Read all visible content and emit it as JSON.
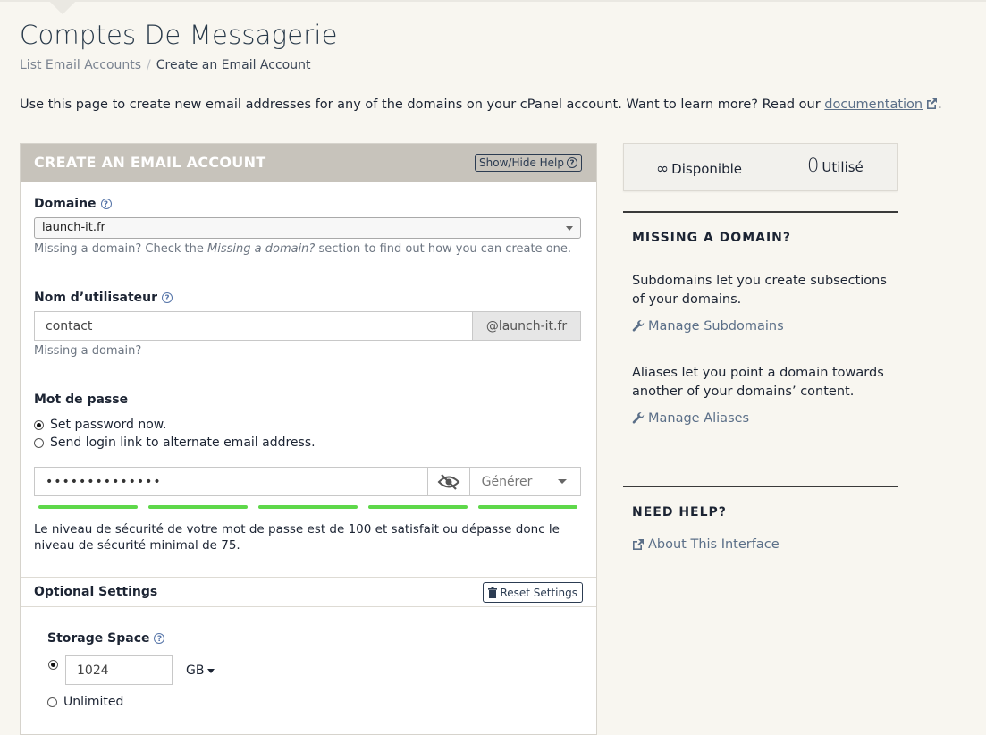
{
  "page": {
    "title": "Comptes De Messagerie",
    "breadcrumb": {
      "link": "List Email Accounts",
      "separator": "/",
      "current": "Create an Email Account"
    },
    "intro_text": "Use this page to create new email addresses for any of the domains on your cPanel account. Want to learn more? Read our",
    "intro_link": "documentation",
    "intro_end": "."
  },
  "form": {
    "header_title": "CREATE AN EMAIL ACCOUNT",
    "help_toggle_label": "Show/Hide Help",
    "domain_label": "Domaine",
    "domain_value": "launch-it.fr",
    "domain_hint_pre": "Missing a domain? Check the ",
    "domain_hint_em": "Missing a domain?",
    "domain_hint_post": " section to find out how you can create one.",
    "username_label": "Nom d’utilisateur",
    "username_value": "contact",
    "username_suffix": "@launch-it.fr",
    "username_hint": "Missing a domain?",
    "password_label": "Mot de passe",
    "password_options": [
      "Set password now.",
      "Send login link to alternate email address."
    ],
    "password_option_selected": 0,
    "password_masked": "••••••••••••••",
    "generate_label": "Générer",
    "strength_bars": 5,
    "strength_text": "Le niveau de sécurité de votre mot de passe est de 100 et satisfait ou dépasse donc le niveau de sécurité minimal de 75.",
    "optional_title": "Optional Settings",
    "reset_label": "Reset Settings",
    "storage_label": "Storage Space",
    "storage_value": "1024",
    "storage_unit": "GB",
    "unlimited_label": "Unlimited"
  },
  "stats": {
    "available_value": "∞",
    "available_label": "Disponible",
    "used_value": "0",
    "used_label": "Utilisé"
  },
  "sidebar": {
    "missing_title": "MISSING A DOMAIN?",
    "subdomains_text": "Subdomains let you create subsections of your domains.",
    "subdomains_link": "Manage Subdomains",
    "aliases_text": "Aliases let you point a domain towards another of your domains’ content.",
    "aliases_link": "Manage Aliases",
    "help_title": "NEED HELP?",
    "about_link": "About This Interface"
  },
  "colors": {
    "accent_link": "#5b6f88",
    "header_bg": "#c7c3bb",
    "strength": "#5ed84a",
    "page_bg": "#f8f6f0"
  }
}
